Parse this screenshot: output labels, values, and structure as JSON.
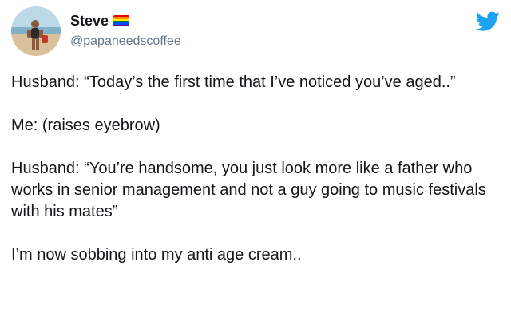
{
  "tweet": {
    "author": {
      "display_name": "Steve",
      "handle": "@papaneedscoffee",
      "avatar": "avatar-photo",
      "badge_icon": "rainbow-flag-icon"
    },
    "brand_icon": "twitter-bird-icon",
    "paragraphs": [
      "Husband: “Today’s the first time that I’ve noticed you’ve aged..”",
      "Me: (raises eyebrow)",
      "Husband: “You’re handsome, you just look more like a father who works in senior management and not a guy going to music festivals with his mates”",
      "I’m now sobbing into my anti age cream.."
    ]
  },
  "colors": {
    "text": "#14171a",
    "muted": "#657786",
    "twitter_blue": "#1da1f2",
    "rainbow": [
      "#e40303",
      "#ff8c00",
      "#ffed00",
      "#008026",
      "#004dff",
      "#750787"
    ]
  }
}
